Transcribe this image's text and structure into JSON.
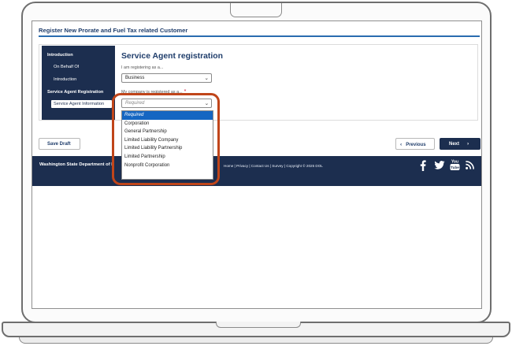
{
  "page": {
    "title": "Register New Prorate and Fuel Tax related Customer"
  },
  "sidebar": {
    "items": [
      {
        "label": "Introduction"
      },
      {
        "label": "On Behalf Of"
      },
      {
        "label": "Introduction"
      },
      {
        "label": "Service Agent Registration"
      },
      {
        "label": "Service Agent Information"
      }
    ]
  },
  "form": {
    "heading": "Service Agent registration",
    "registering_label": "I am registering as a...",
    "registering_value": "Business",
    "company_label": "My company is registered as a...",
    "company_required_mark": "*",
    "company_value": "Required"
  },
  "dropdown": {
    "options": [
      {
        "label": "Required",
        "selected": true
      },
      {
        "label": "Corporation",
        "selected": false
      },
      {
        "label": "General Partnership",
        "selected": false
      },
      {
        "label": "Limited Liability Company",
        "selected": false
      },
      {
        "label": "Limited Liability Partnership",
        "selected": false
      },
      {
        "label": "Limited Partnership",
        "selected": false
      },
      {
        "label": "Nonprofit Corporation",
        "selected": false
      }
    ]
  },
  "buttons": {
    "save_draft": "Save Draft",
    "previous": "Previous",
    "next": "Next",
    "previous_arrow": "‹",
    "next_arrow": "›"
  },
  "footer": {
    "brand": "Washington State Department of L",
    "links": "Home | Privacy | Contact Us | Survey | Copyright © 2025 DOL",
    "social_icons": [
      "facebook-icon",
      "twitter-icon",
      "youtube-icon",
      "rss-icon"
    ]
  },
  "colors": {
    "navy": "#1c2e4f",
    "accent_blue": "#2a6cb0",
    "selected_option": "#1566c2",
    "highlight_ring": "#c0451a",
    "required_star": "#c8102e"
  }
}
